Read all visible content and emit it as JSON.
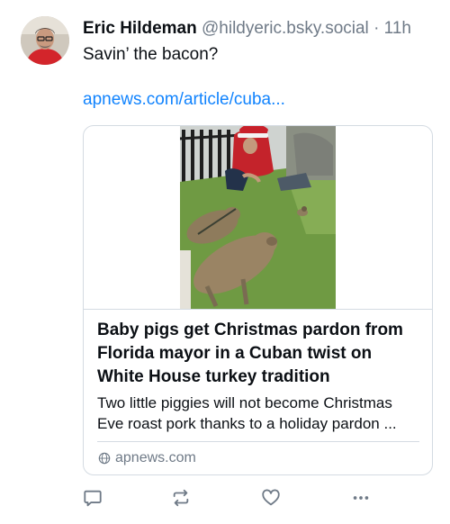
{
  "post": {
    "author": {
      "display_name": "Eric Hildeman",
      "handle": "@hildyeric.bsky.social",
      "separator": "·",
      "timestamp": "11h",
      "avatar": "avatar-photo"
    },
    "text": "Savin’ the bacon?",
    "link_text": "apnews.com/article/cuba...",
    "embed": {
      "thumbnail": "pigs-photo",
      "title_lines": [
        "Baby pigs get Christmas pardon from",
        "Florida mayor in a Cuban twist on",
        "White House turkey tradition"
      ],
      "description_lines": [
        "Two little piggies will not become Christmas",
        "Eve roast pork thanks to a holiday pardon ..."
      ],
      "domain": "apnews.com",
      "domain_icon": "globe-icon"
    },
    "actions": [
      {
        "name": "reply",
        "icon": "speech-bubble-icon"
      },
      {
        "name": "repost",
        "icon": "repost-arrows-icon"
      },
      {
        "name": "like",
        "icon": "heart-icon"
      },
      {
        "name": "more",
        "icon": "ellipsis-icon"
      }
    ]
  },
  "colors": {
    "text": "#0b0f14",
    "muted": "#6f7a87",
    "link": "#1083fe",
    "border": "#d4dbe2"
  }
}
